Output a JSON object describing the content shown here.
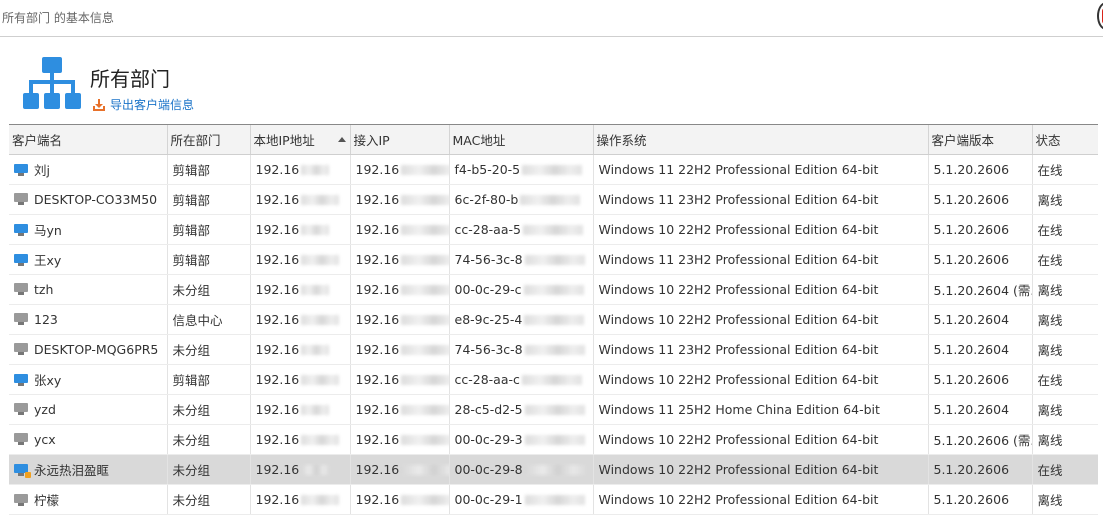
{
  "window": {
    "title": "所有部门 的基本信息"
  },
  "department": {
    "name": "所有部门",
    "export_label": "导出客户端信息"
  },
  "table": {
    "columns": [
      "客户端名",
      "所在部门",
      "本地IP地址",
      "接入IP",
      "MAC地址",
      "操作系统",
      "客户端版本",
      "状态"
    ],
    "sorted_column": "本地IP地址",
    "rows": [
      {
        "name": "刘j",
        "dept": "剪辑部",
        "local_ip": "192.16",
        "access_ip": "192.16",
        "mac": "f4-b5-20-5",
        "os": "Windows 11 22H2 Professional Edition 64-bit",
        "version": "5.1.20.2606",
        "status": "在线",
        "online": true
      },
      {
        "name": "DESKTOP-CO33M50",
        "dept": "剪辑部",
        "local_ip": "192.16",
        "access_ip": "192.16",
        "mac": "6c-2f-80-b",
        "os": "Windows 11 23H2 Professional Edition 64-bit",
        "version": "5.1.20.2606",
        "status": "离线",
        "online": false
      },
      {
        "name": "马yn",
        "dept": "剪辑部",
        "local_ip": "192.16",
        "access_ip": "192.16",
        "mac": "cc-28-aa-5",
        "os": "Windows 10 22H2 Professional Edition 64-bit",
        "version": "5.1.20.2606",
        "status": "在线",
        "online": true
      },
      {
        "name": "王xy",
        "dept": "剪辑部",
        "local_ip": "192.16",
        "access_ip": "192.16",
        "mac": "74-56-3c-8",
        "os": "Windows 11 23H2 Professional Edition 64-bit",
        "version": "5.1.20.2606",
        "status": "在线",
        "online": true
      },
      {
        "name": "tzh",
        "dept": "未分组",
        "local_ip": "192.16",
        "access_ip": "192.16",
        "mac": "00-0c-29-c",
        "os": "Windows 10 22H2 Professional Edition 64-bit",
        "version": "5.1.20.2604 (需...",
        "status": "离线",
        "online": false
      },
      {
        "name": "123",
        "dept": "信息中心",
        "local_ip": "192.16",
        "access_ip": "192.16",
        "mac": "e8-9c-25-4",
        "os": "Windows 10 22H2 Professional Edition 64-bit",
        "version": "5.1.20.2604",
        "status": "离线",
        "online": false
      },
      {
        "name": "DESKTOP-MQG6PR5",
        "dept": "未分组",
        "local_ip": "192.16",
        "access_ip": "192.16",
        "mac": "74-56-3c-8",
        "os": "Windows 11 23H2 Professional Edition 64-bit",
        "version": "5.1.20.2604",
        "status": "离线",
        "online": false
      },
      {
        "name": "张xy",
        "dept": "剪辑部",
        "local_ip": "192.16",
        "access_ip": "192.16",
        "mac": "cc-28-aa-c",
        "os": "Windows 10 22H2 Professional Edition 64-bit",
        "version": "5.1.20.2606",
        "status": "在线",
        "online": true
      },
      {
        "name": "yzd",
        "dept": "未分组",
        "local_ip": "192.16",
        "access_ip": "192.16",
        "mac": "28-c5-d2-5",
        "os": "Windows 11 25H2 Home China Edition 64-bit",
        "version": "5.1.20.2604",
        "status": "离线",
        "online": false
      },
      {
        "name": "ycx",
        "dept": "未分组",
        "local_ip": "192.16",
        "access_ip": "192.16",
        "mac": "00-0c-29-3",
        "os": "Windows 10 22H2 Professional Edition 64-bit",
        "version": "5.1.20.2606 (需...",
        "status": "离线",
        "online": false
      },
      {
        "name": "永远热泪盈眶",
        "dept": "未分组",
        "local_ip": "192.16",
        "access_ip": "192.16",
        "mac": "00-0c-29-8",
        "os": "Windows 10 22H2 Professional Edition 64-bit",
        "version": "5.1.20.2606",
        "status": "在线",
        "online": true,
        "locked": true,
        "selected": true
      },
      {
        "name": "柠檬",
        "dept": "未分组",
        "local_ip": "192.16",
        "access_ip": "192.16",
        "mac": "00-0c-29-1",
        "os": "Windows 10 22H2 Professional Edition 64-bit",
        "version": "5.1.20.2606",
        "status": "离线",
        "online": false
      }
    ]
  },
  "colors": {
    "accent": "#2e8ee0",
    "link": "#1a73c8",
    "online_icon": "#2e8ee0",
    "offline_icon": "#9a9a9a",
    "export_icon": "#e8712a",
    "selected_row": "#d9d9d9"
  },
  "icons": {
    "department": "org-chart-icon",
    "export": "download-icon",
    "client_online": "computer-online-icon",
    "client_offline": "computer-offline-icon",
    "sort": "sort-ascending-icon"
  }
}
